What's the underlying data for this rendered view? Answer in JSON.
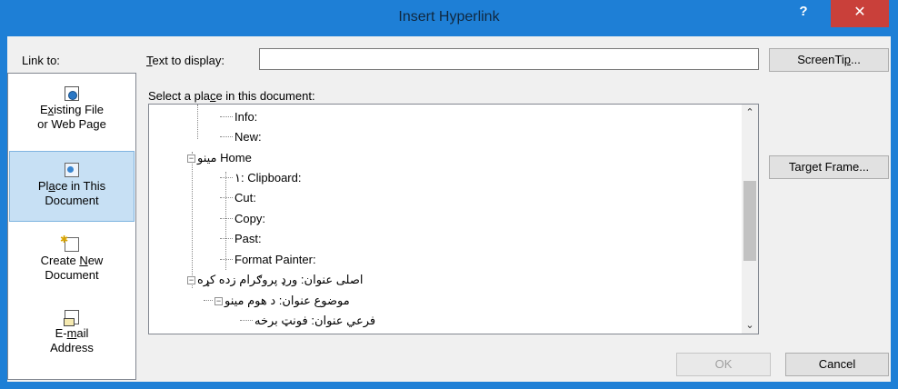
{
  "window": {
    "title": "Insert Hyperlink",
    "help_label": "?",
    "close_label": "✕"
  },
  "link_to": {
    "label": "Link to:",
    "items": [
      {
        "pre": "E",
        "u": "x",
        "post": "isting File",
        "line2": "or Web Page",
        "icon": "existing-file-icon"
      },
      {
        "pre": "Pl",
        "u": "a",
        "post": "ce in This",
        "line2": "Document",
        "icon": "place-in-document-icon"
      },
      {
        "pre": "Create ",
        "u": "N",
        "post": "ew",
        "line2": "Document",
        "icon": "new-document-icon"
      },
      {
        "pre": "E-",
        "u": "m",
        "post": "ail",
        "line2": "Address",
        "icon": "email-icon"
      }
    ]
  },
  "text_to_display": {
    "label_pre": "",
    "label_u": "T",
    "label_post": "ext to display:",
    "value": ""
  },
  "place_section": {
    "label_pre": "Select a pla",
    "label_u": "c",
    "label_post": "e in this document:"
  },
  "tree": {
    "items": [
      "Info:",
      "New:",
      "مینو Home",
      "١: Clipboard:",
      "Cut:",
      "Copy:",
      "Past:",
      "Format Painter:",
      "اصلی عنوان: ورډ پروګرام زده کړه",
      "موضوع عنوان: د هوم مینو",
      "فرعي عنوان: فونټ برخه"
    ]
  },
  "buttons": {
    "screentip_pre": "ScreenTi",
    "screentip_u": "p",
    "screentip_post": "...",
    "target_pre": "Tar",
    "target_u": "g",
    "target_post": "et Frame...",
    "ok": "OK",
    "cancel": "Cancel"
  },
  "colors": {
    "titlebar": "#1e7fd6",
    "close": "#c9403a",
    "selected": "#c7e0f4"
  }
}
